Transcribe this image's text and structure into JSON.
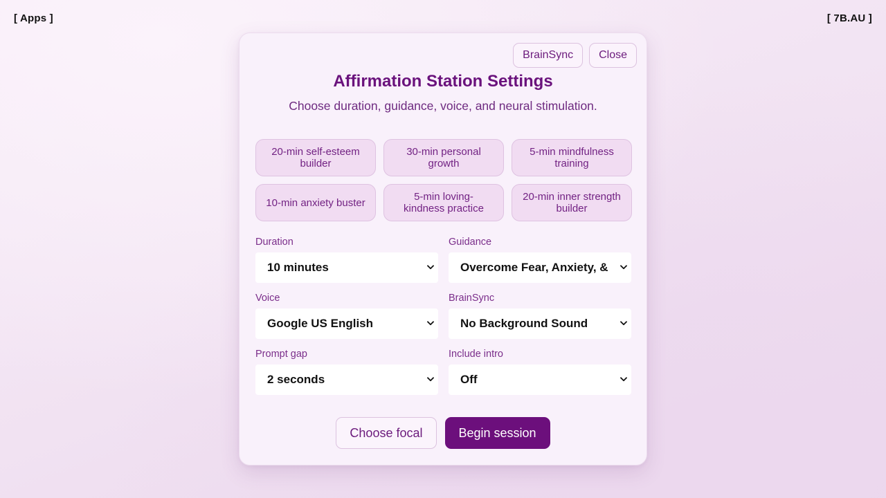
{
  "corner": {
    "apps_label": "[ Apps ]",
    "site_label": "[ 7B.AU ]"
  },
  "panel": {
    "brainsync_button": "BrainSync",
    "close_button": "Close",
    "title": "Affirmation Station Settings",
    "subtitle": "Choose duration, guidance, voice, and neural stimulation."
  },
  "presets": [
    {
      "label": "20-min self-esteem builder"
    },
    {
      "label": "30-min personal growth"
    },
    {
      "label": "5-min mindfulness training"
    },
    {
      "label": "10-min anxiety buster"
    },
    {
      "label": "5-min loving-kindness practice"
    },
    {
      "label": "20-min inner strength builder"
    }
  ],
  "fields": {
    "duration": {
      "label": "Duration",
      "value": "10 minutes"
    },
    "guidance": {
      "label": "Guidance",
      "value": "Overcome Fear, Anxiety, & U"
    },
    "voice": {
      "label": "Voice",
      "value": "Google US English"
    },
    "brainsync": {
      "label": "BrainSync",
      "value": "No Background Sound"
    },
    "prompt_gap": {
      "label": "Prompt gap",
      "value": "2 seconds"
    },
    "include_intro": {
      "label": "Include intro",
      "value": "Off"
    }
  },
  "actions": {
    "choose_focal": "Choose focal",
    "begin_session": "Begin session"
  },
  "icons": {
    "select_arrow": "chevron-down-icon"
  },
  "colors": {
    "accent": "#6c0f7c",
    "title": "#6a127c",
    "preset_bg": "#f1dcf2",
    "panel_bg": "#f9f1fb"
  }
}
